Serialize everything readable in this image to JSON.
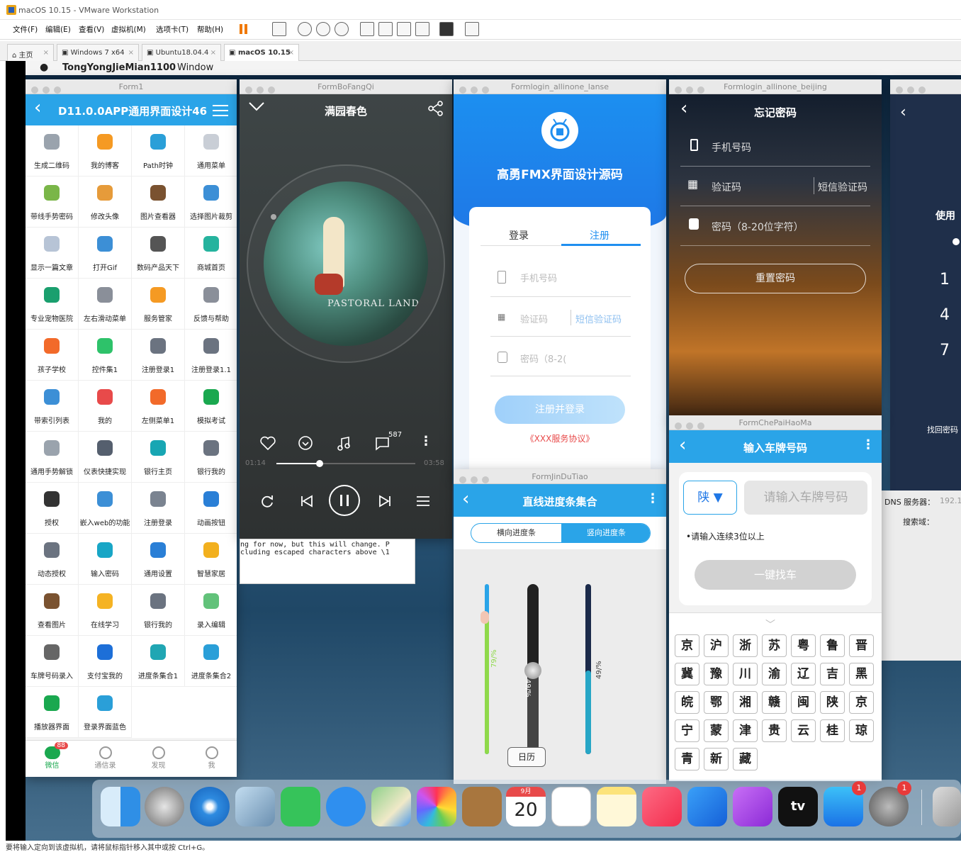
{
  "host": {
    "title": "macOS 10.15 - VMware Workstation",
    "menus": [
      "文件(F)",
      "编辑(E)",
      "查看(V)",
      "虚拟机(M)",
      "选项卡(T)",
      "帮助(H)"
    ],
    "tabs": [
      {
        "label": "主页"
      },
      {
        "label": "Windows 7 x64"
      },
      {
        "label": "Ubuntu18.04.4"
      },
      {
        "label": "macOS 10.15"
      }
    ],
    "status": "要将输入定向到该虚拟机，请将鼠标指针移入其中或按 Ctrl+G。"
  },
  "mac_menubar": {
    "app": "TongYongJieMian1100",
    "menu": "Window"
  },
  "form1": {
    "window_title": "Form1",
    "header_title": "D11.0.0APP通用界面设计46",
    "items": [
      "生成二维码",
      "我的博客",
      "Path时钟",
      "通用菜单",
      "带线手势密码",
      "修改头像",
      "图片查看器",
      "选择图片裁剪",
      "显示一篇文章",
      "打开Gif",
      "数码产品天下",
      "商城首页",
      "专业宠物医院",
      "左右滑动菜单",
      "服务管家",
      "反馈与帮助",
      "孩子学校",
      "控件集1",
      "注册登录1",
      "注册登录1.1",
      "带索引列表",
      "我的",
      "左侧菜单1",
      "模拟考试",
      "通用手势解锁",
      "仪表快捷实现",
      "银行主页",
      "银行我的",
      "授权",
      "嵌入web的功能",
      "注册登录",
      "动画按钮",
      "动态授权",
      "输入密码",
      "通用设置",
      "智慧家居",
      "查看图片",
      "在线学习",
      "银行我的",
      "录入编辑",
      "车牌号码录入",
      "支付宝我的",
      "进度条集合1",
      "进度条集合2",
      "播放器界面",
      "登录界面蓝色"
    ],
    "item_colors": [
      "#9aa3ad",
      "#f59a23",
      "#2a9fd8",
      "#c9ced6",
      "#7ab648",
      "#e69b3a",
      "#7a5230",
      "#3c8fd6",
      "#b7c4d6",
      "#3c8fd6",
      "#555555",
      "#25b39e",
      "#1a9f6e",
      "#8a8f99",
      "#f59a23",
      "#8a8f99",
      "#f26a2a",
      "#2ec26a",
      "#6b7380",
      "#6b7380",
      "#3c8fd6",
      "#e84a4a",
      "#f26a2a",
      "#1aa84f",
      "#9aa3ad",
      "#555f6e",
      "#18a6b3",
      "#6b7380",
      "#333333",
      "#3c8fd6",
      "#7a8390",
      "#2a7fd6",
      "#6b7380",
      "#18a6c6",
      "#2a7fd6",
      "#f2b01e",
      "#7a5230",
      "#f5b323",
      "#6b7380",
      "#62c27a",
      "#666666",
      "#1d6fd8",
      "#20a6b3",
      "#2a9fd8",
      "#1aa84f",
      "#2a9fd8"
    ],
    "bottom_nav": [
      {
        "label": "微信",
        "badge": "88"
      },
      {
        "label": "通信录"
      },
      {
        "label": "发现"
      },
      {
        "label": "我"
      }
    ]
  },
  "player": {
    "window_title": "FormBoFangQi",
    "song_title": "满园春色",
    "comment_count": "587",
    "time_current": "01:14",
    "time_total": "03:58",
    "progress": 0.31,
    "album_text": "PASTORAL LANDSC",
    "console_line1": "ng for now, but this will change. P",
    "console_line2": "cluding escaped characters above \\1"
  },
  "login": {
    "window_title": "Formlogin_allinone_lanse",
    "app_title": "高勇FMX界面设计源码",
    "tab_login": "登录",
    "tab_register": "注册",
    "phone_placeholder": "手机号码",
    "code_placeholder": "验证码",
    "sms_code": "短信验证码",
    "password_placeholder": "密码（8-2(",
    "submit": "注册并登录",
    "agreement": "《XXX服务协议》"
  },
  "progress_win": {
    "window_title": "FormJinDuTiao",
    "header_title": "直线进度条集合",
    "tab_horizontal": "横向进度条",
    "tab_vertical": "竖向进度条",
    "bar1_label": "79/%",
    "bar1_value": 0.79,
    "bar2_label": "49/%",
    "bar2_value": 0.49,
    "bar3_label": "49/%",
    "bar3_value": 0.49,
    "tooltip": "日历"
  },
  "forgot": {
    "window_title": "Formlogin_allinone_beijing",
    "header_title": "忘记密码",
    "phone": "手机号码",
    "code": "验证码",
    "sms_code": "短信验证码",
    "password": "密码（8-20位字符）",
    "reset": "重置密码"
  },
  "plate": {
    "window_title": "FormChePaiHaoMa",
    "header_title": "输入车牌号码",
    "province": "陕",
    "input_placeholder": "请输入车牌号码",
    "hint": "•请输入连续3位以上",
    "search": "一键找车",
    "keys": [
      [
        "京",
        "沪",
        "浙",
        "苏",
        "粤",
        "鲁",
        "晋"
      ],
      [
        "冀",
        "豫",
        "川",
        "渝",
        "辽",
        "吉",
        "黑"
      ],
      [
        "皖",
        "鄂",
        "湘",
        "赣",
        "闽",
        "陕",
        "京"
      ],
      [
        "宁",
        "蒙",
        "津",
        "贵",
        "云",
        "桂",
        "琼"
      ],
      [
        "青",
        "新",
        "藏"
      ]
    ]
  },
  "partial": {
    "use_text": "使用",
    "keypad": [
      "1",
      "4",
      "7"
    ],
    "find_pwd": "找回密码",
    "dns": "DNS 服务器：",
    "dns_value": "192.1",
    "search_domain": "搜索域："
  },
  "dock": {
    "calendar_month": "9月",
    "calendar_day": "20",
    "tv_label": "tv",
    "appstore_badge": "1",
    "settings_badge": "1"
  }
}
